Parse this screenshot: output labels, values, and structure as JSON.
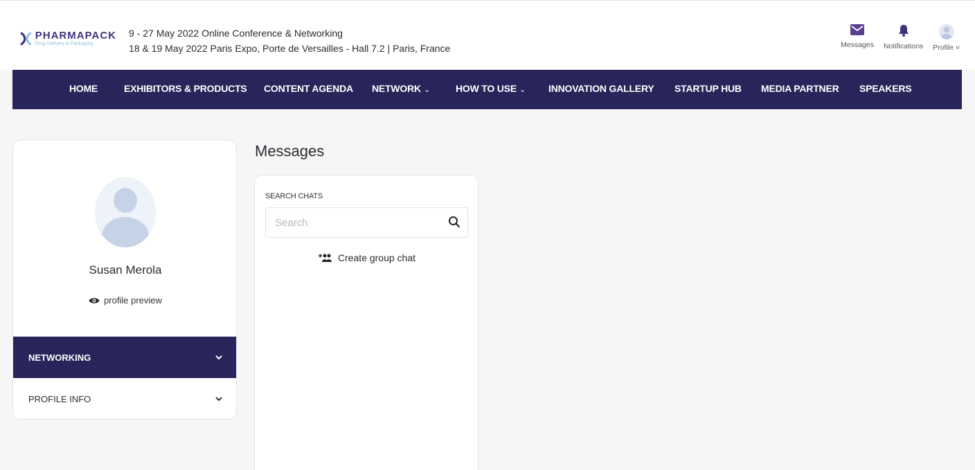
{
  "header": {
    "logo": {
      "name": "PHARMAPACK",
      "tagline": "Drug Delivery & Packaging"
    },
    "event_online": {
      "dates": "9 - 27 May 2022",
      "desc": "Online Conference & Networking"
    },
    "event_onsite": {
      "dates": "18 & 19 May 2022",
      "desc": "Paris Expo, Porte de Versailles - Hall 7.2 | Paris, France"
    },
    "icons": [
      {
        "label": "Messages",
        "icon": "envelope-icon"
      },
      {
        "label": "Notifications",
        "icon": "bell-icon"
      },
      {
        "label": "Profile",
        "icon": "avatar"
      }
    ]
  },
  "nav": {
    "items": [
      {
        "label": "HOME"
      },
      {
        "label": "EXHIBITORS & PRODUCTS"
      },
      {
        "label": "CONTENT AGENDA"
      },
      {
        "label": "NETWORK",
        "dropdown": true
      },
      {
        "label": "HOW TO USE",
        "dropdown": true
      },
      {
        "label": "INNOVATION GALLERY"
      },
      {
        "label": "STARTUP HUB"
      },
      {
        "label": "MEDIA PARTNER"
      },
      {
        "label": "SPEAKERS"
      }
    ]
  },
  "profile": {
    "name": "Susan Merola",
    "preview_label": "profile preview",
    "sections": [
      {
        "label": "NETWORKING",
        "active": true
      },
      {
        "label": "PROFILE INFO",
        "active": false
      }
    ]
  },
  "messages": {
    "title": "Messages",
    "search_label": "SEARCH CHATS",
    "search_placeholder": "Search",
    "create_group_label": "Create group chat"
  },
  "colors": {
    "nav_bg": "#28255a",
    "brand": "#3d3480",
    "page_bg": "#f6f6f7"
  }
}
